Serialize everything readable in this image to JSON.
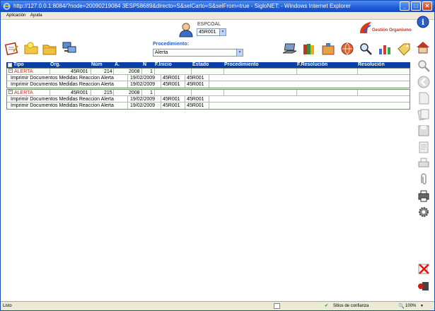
{
  "window": {
    "title": "http://127.0.0.1:8084/?node=20090219084 3ESP58689&directo=S&selCarto=S&selFrom=true - SigloNET: - Windows Internet Explorer",
    "title_text": "http://127.0.0.1:8084/?node=20090219084 3ESP58689&directo=S&selCarto=S&selFrom=true - SigloNET: - Windows Internet Explorer"
  },
  "menu": {
    "items": [
      "Aplicación",
      "Ayuda"
    ]
  },
  "header": {
    "user_label": "ESPCOAL",
    "user_select": "45R001",
    "procedure_label": "Procedimiento:",
    "procedure_select": "Alerta",
    "org_label": "Gestión Organismo"
  },
  "grid": {
    "columns": [
      "Tipo",
      "Org.",
      "Núm",
      "A.",
      "N",
      "F.Inicio",
      "Estado",
      "Procedimiento",
      "F.Resolución",
      "Resolución"
    ],
    "groups": [
      {
        "tipo": "ALERTA",
        "org": "45R001",
        "num": "214",
        "anio": "2008",
        "n": "1",
        "rows": [
          {
            "desc": "Imprimir Documentos Medidas Reaccion Alerta",
            "fecha": "19/02/2009",
            "c1": "45R001",
            "c2": "45R001"
          },
          {
            "desc": "Imprimir Documentos Medidas Reaccion Alerta",
            "fecha": "19/02/2009",
            "c1": "45R001",
            "c2": "45R001"
          }
        ]
      },
      {
        "tipo": "ALERTA",
        "org": "45R001",
        "num": "215",
        "anio": "2008",
        "n": "1",
        "rows": [
          {
            "desc": "Imprimir Documentos Medidas Reaccion Alerta",
            "fecha": "19/02/2009",
            "c1": "45R001",
            "c2": "45R001"
          },
          {
            "desc": "Imprimir Documentos Medidas Reaccion Alerta",
            "fecha": "19/02/2009",
            "c1": "45R001",
            "c2": "45R001"
          }
        ]
      }
    ]
  },
  "status": {
    "left": "Listo",
    "zone": "Sitios de confianza",
    "zoom": "100%"
  },
  "icons": {
    "toolbar_left": [
      "edit-form-icon",
      "folder-star-icon",
      "folder-icon",
      "computer-transfer-icon"
    ],
    "toolbar_right": [
      "laptop-icon",
      "books-icon",
      "archive-icon",
      "globe-icon",
      "search-tool-icon",
      "chart-icon",
      "tag-icon",
      "home-icon"
    ],
    "sidebar": [
      "magnifier-icon",
      "back-icon",
      "document-icon",
      "documents-icon",
      "save-icon",
      "notepad-icon",
      "print-icon",
      "attach-icon",
      "printer-icon",
      "gear-icon",
      "cancel-icon",
      "exit-icon"
    ]
  }
}
